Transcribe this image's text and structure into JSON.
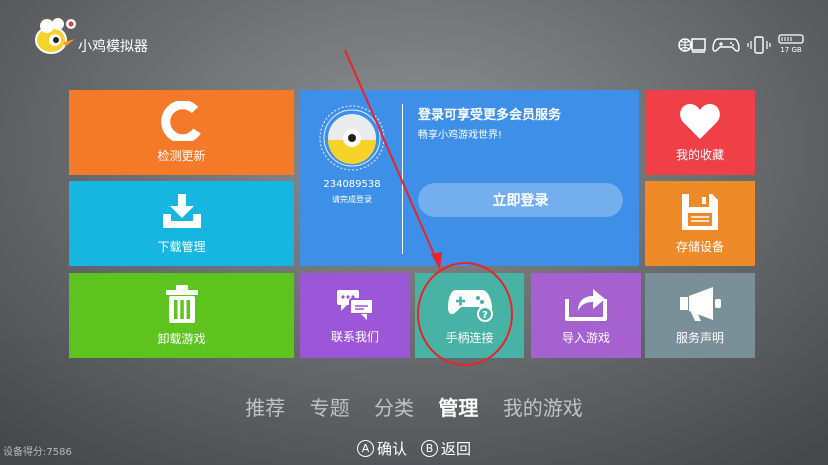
{
  "app": {
    "title": "小鸡模拟器"
  },
  "status": {
    "storage_label": "17 GB"
  },
  "tiles": {
    "check_update": "检测更新",
    "download_manager": "下载管理",
    "uninstall_games": "卸载游戏",
    "favorites": "我的收藏",
    "storage_device": "存储设备",
    "contact_us": "联系我们",
    "controller_connect": "手柄连接",
    "import_games": "导入游戏",
    "service_statement": "服务声明"
  },
  "login_panel": {
    "user_id": "234089538",
    "prompt": "请完成登录",
    "heading": "登录可享受更多会员服务",
    "subheading": "畅享小鸡游戏世界!",
    "login_button": "立即登录"
  },
  "nav": {
    "tabs": [
      "推荐",
      "专题",
      "分类",
      "管理",
      "我的游戏"
    ],
    "active": "管理"
  },
  "hints": {
    "confirm_key": "A",
    "confirm_label": "确认",
    "back_key": "B",
    "back_label": "返回"
  },
  "footer": {
    "device_score": "设备得分:7586"
  },
  "colors": {
    "orange": "#f47a29",
    "cyan": "#16b6e0",
    "green": "#5fc31f",
    "blue": "#3d8fe8",
    "red": "#ee4046",
    "amber": "#ef8a29",
    "purple": "#9c56d8",
    "teal": "#48b3a4",
    "violet": "#a461cf",
    "slate": "#7a9099",
    "annotation": "#e8232a"
  }
}
